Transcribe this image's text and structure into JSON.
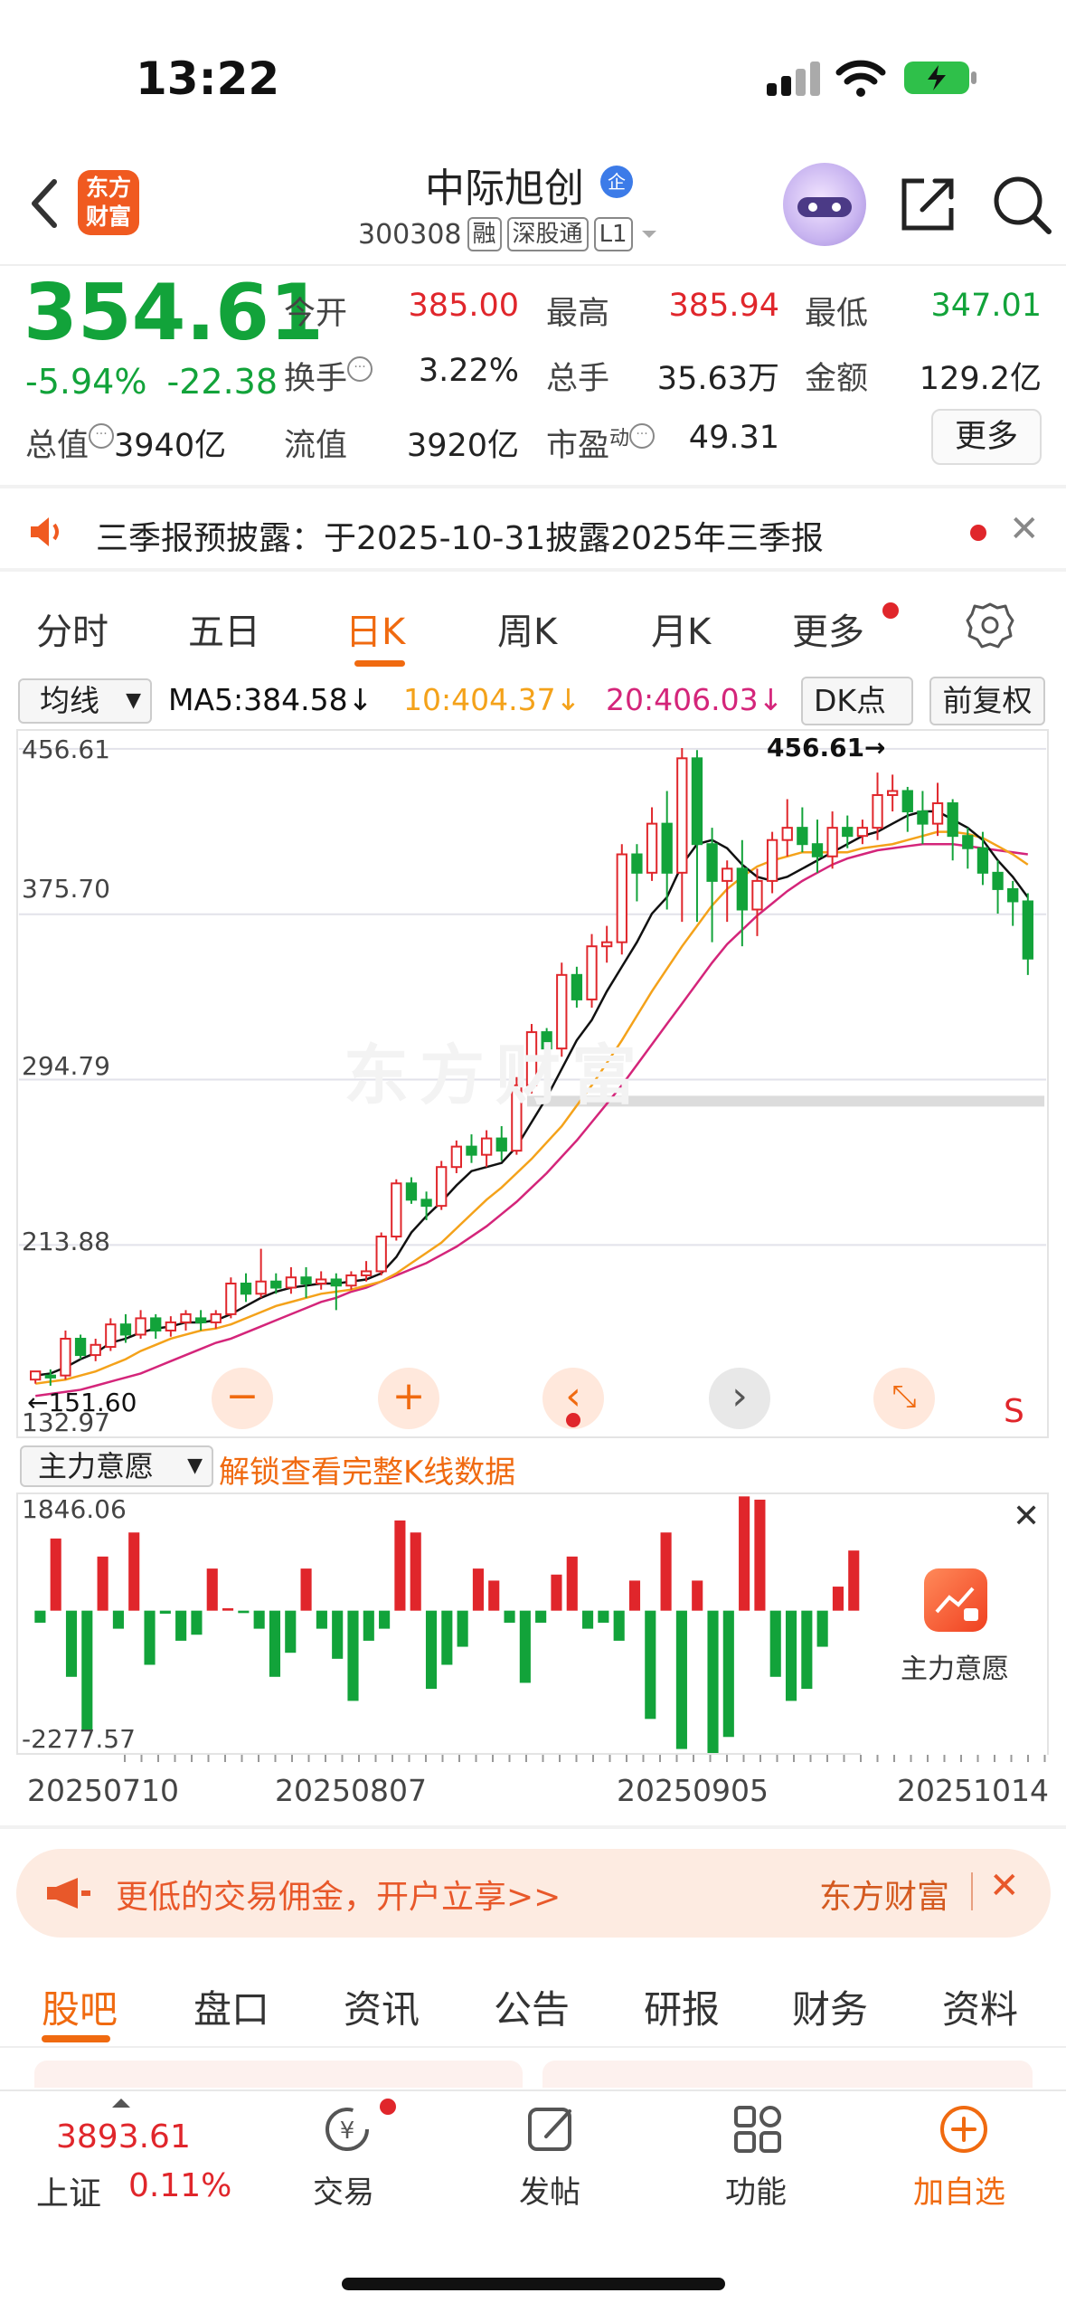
{
  "status_bar": {
    "time": "13:22"
  },
  "header": {
    "brand": "东方财富",
    "stock_name": "中际旭创",
    "stock_code": "300308",
    "tags": [
      "融",
      "深股通",
      "L1"
    ]
  },
  "quote": {
    "price": "354.61",
    "change_pct": "-5.94%",
    "change_amt": "-22.38",
    "open_label": "今开",
    "open": "385.00",
    "high_label": "最高",
    "high": "385.94",
    "low_label": "最低",
    "low": "347.01",
    "turnover_label": "换手",
    "turnover": "3.22%",
    "volume_label": "总手",
    "volume": "35.63万",
    "amount_label": "金额",
    "amount": "129.2亿",
    "mktcap_label": "总值",
    "mktcap": "3940亿",
    "float_label": "流值",
    "float_cap": "3920亿",
    "pe_label": "市盈",
    "pe_sup": "动",
    "pe": "49.31",
    "more_label": "更多"
  },
  "notice": {
    "text": "三季报预披露：于2025-10-31披露2025年三季报"
  },
  "period_tabs": [
    "分时",
    "五日",
    "日K",
    "周K",
    "月K",
    "更多"
  ],
  "indicator_bar": {
    "ma_select": "均线",
    "ma5": "MA5:384.58↓",
    "ma10": "10:404.37↓",
    "ma20": "20:406.03↓",
    "dk_label": "DK点",
    "adj_label": "前复权"
  },
  "colors": {
    "up": "#e0262b",
    "down": "#12a33a",
    "ma5": "#111111",
    "ma10": "#f4a21a",
    "ma20": "#d4257a",
    "accent": "#f06a10"
  },
  "chart_data": {
    "type": "candlestick",
    "y_ticks": [
      "456.61",
      "375.70",
      "294.79",
      "213.88",
      "132.97"
    ],
    "ylim": [
      132.97,
      456.61
    ],
    "max_label": "456.61→",
    "min_label": "←151.60",
    "candles": [
      [
        148,
        152,
        146,
        152
      ],
      [
        150,
        149,
        145,
        153
      ],
      [
        150,
        168,
        148,
        172
      ],
      [
        168,
        160,
        158,
        170
      ],
      [
        160,
        165,
        157,
        168
      ],
      [
        164,
        175,
        162,
        178
      ],
      [
        175,
        170,
        166,
        180
      ],
      [
        170,
        178,
        168,
        182
      ],
      [
        178,
        172,
        168,
        180
      ],
      [
        172,
        176,
        169,
        179
      ],
      [
        176,
        180,
        172,
        182
      ],
      [
        178,
        176,
        172,
        182
      ],
      [
        176,
        180,
        173,
        182
      ],
      [
        180,
        195,
        178,
        198
      ],
      [
        195,
        190,
        186,
        200
      ],
      [
        190,
        196,
        188,
        212
      ],
      [
        196,
        193,
        190,
        200
      ],
      [
        193,
        198,
        190,
        203
      ],
      [
        198,
        195,
        188,
        203
      ],
      [
        195,
        197,
        192,
        201
      ],
      [
        197,
        194,
        182,
        200
      ],
      [
        194,
        199,
        192,
        201
      ],
      [
        199,
        201,
        196,
        206
      ],
      [
        201,
        218,
        199,
        220
      ],
      [
        218,
        244,
        216,
        246
      ],
      [
        244,
        236,
        234,
        247
      ],
      [
        236,
        233,
        226,
        240
      ],
      [
        233,
        252,
        231,
        255
      ],
      [
        252,
        262,
        249,
        265
      ],
      [
        262,
        258,
        254,
        268
      ],
      [
        258,
        266,
        252,
        270
      ],
      [
        266,
        260,
        255,
        272
      ],
      [
        260,
        292,
        258,
        296
      ],
      [
        292,
        318,
        288,
        322
      ],
      [
        318,
        310,
        306,
        320
      ],
      [
        310,
        346,
        306,
        352
      ],
      [
        346,
        334,
        330,
        350
      ],
      [
        334,
        360,
        330,
        366
      ],
      [
        360,
        362,
        352,
        370
      ],
      [
        362,
        405,
        356,
        410
      ],
      [
        405,
        396,
        382,
        410
      ],
      [
        396,
        420,
        392,
        428
      ],
      [
        420,
        396,
        378,
        436
      ],
      [
        396,
        452,
        372,
        457
      ],
      [
        452,
        410,
        372,
        456
      ],
      [
        410,
        392,
        362,
        418
      ],
      [
        392,
        398,
        372,
        402
      ],
      [
        398,
        378,
        360,
        412
      ],
      [
        378,
        392,
        365,
        398
      ],
      [
        392,
        412,
        386,
        416
      ],
      [
        412,
        418,
        404,
        432
      ],
      [
        418,
        410,
        406,
        428
      ],
      [
        410,
        404,
        396,
        422
      ],
      [
        404,
        418,
        398,
        426
      ],
      [
        418,
        414,
        408,
        424
      ],
      [
        414,
        418,
        410,
        422
      ],
      [
        418,
        434,
        412,
        445
      ],
      [
        434,
        436,
        426,
        444
      ],
      [
        436,
        426,
        416,
        438
      ],
      [
        426,
        420,
        410,
        436
      ],
      [
        420,
        430,
        414,
        440
      ],
      [
        430,
        414,
        402,
        432
      ],
      [
        414,
        408,
        398,
        418
      ],
      [
        408,
        396,
        390,
        416
      ],
      [
        396,
        388,
        376,
        402
      ],
      [
        388,
        382,
        370,
        392
      ],
      [
        382,
        354,
        346,
        386
      ]
    ],
    "ma5": [
      150,
      151,
      154,
      158,
      161,
      166,
      168,
      171,
      173,
      174,
      176,
      176,
      177,
      180,
      184,
      188,
      191,
      193,
      194,
      195,
      195,
      196,
      197,
      200,
      208,
      220,
      228,
      235,
      243,
      250,
      252,
      254,
      262,
      274,
      286,
      300,
      314,
      324,
      338,
      350,
      362,
      376,
      384,
      400,
      410,
      412,
      408,
      400,
      394,
      392,
      394,
      398,
      402,
      406,
      410,
      414,
      416,
      420,
      424,
      426,
      426,
      422,
      418,
      412,
      402,
      394,
      384
    ],
    "ma10": [
      146,
      147,
      148,
      150,
      152,
      155,
      158,
      162,
      165,
      168,
      170,
      172,
      173,
      175,
      178,
      181,
      184,
      186,
      188,
      190,
      191,
      192,
      194,
      196,
      200,
      205,
      210,
      215,
      222,
      229,
      236,
      242,
      249,
      256,
      264,
      272,
      282,
      292,
      303,
      314,
      326,
      338,
      349,
      360,
      370,
      380,
      388,
      394,
      399,
      402,
      404,
      406,
      406,
      406,
      406,
      408,
      409,
      410,
      412,
      414,
      416,
      416,
      415,
      413,
      409,
      405,
      400
    ],
    "ma20": [
      140,
      141,
      142,
      143,
      145,
      147,
      149,
      151,
      154,
      157,
      160,
      163,
      166,
      168,
      171,
      174,
      177,
      180,
      183,
      186,
      188,
      191,
      193,
      196,
      199,
      202,
      205,
      209,
      213,
      218,
      223,
      229,
      235,
      242,
      249,
      257,
      265,
      274,
      283,
      292,
      302,
      312,
      322,
      332,
      342,
      352,
      361,
      368,
      375,
      381,
      387,
      392,
      396,
      400,
      403,
      405,
      407,
      408,
      409,
      410,
      410,
      410,
      409,
      408,
      407,
      406,
      405
    ],
    "intent": {
      "y_ticks": [
        "1846.06",
        "-2277.57"
      ],
      "ylim": [
        -2277.57,
        1846.06
      ],
      "values": [
        -200,
        1200,
        -1100,
        -2000,
        900,
        -300,
        1300,
        -900,
        -50,
        -500,
        -400,
        700,
        40,
        -40,
        -300,
        -1100,
        -700,
        700,
        -300,
        -800,
        -1500,
        -500,
        -300,
        1500,
        1300,
        -1300,
        -900,
        -600,
        700,
        500,
        -200,
        -1200,
        -200,
        600,
        900,
        -300,
        -200,
        -500,
        500,
        -1800,
        1300,
        -2300,
        500,
        -2400,
        -2100,
        1900,
        1846,
        -1100,
        -1500,
        -1300,
        -600,
        400,
        1000
      ],
      "x_ticks": [
        "20250710",
        "20250807",
        "20250905",
        "20251014"
      ],
      "card_label": "主力意愿"
    }
  },
  "sub_indicator": {
    "select": "主力意愿",
    "unlock": "解锁查看完整K线数据"
  },
  "ad": {
    "text": "更低的交易佣金，开户立享>>",
    "brand": "东方财富"
  },
  "bottom_tabs": [
    "股吧",
    "盘口",
    "资讯",
    "公告",
    "研报",
    "财务",
    "资料"
  ],
  "bottom_nav": {
    "index_price": "3893.61",
    "index_name": "上证",
    "index_change": "0.11%",
    "items": [
      "交易",
      "发帖",
      "功能",
      "加自选"
    ]
  }
}
